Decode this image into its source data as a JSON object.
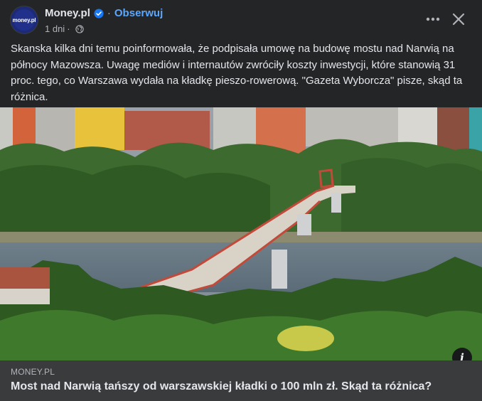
{
  "header": {
    "avatar_text": "money.pl",
    "page_name": "Money.pl",
    "separator": "·",
    "follow_label": "Obserwuj",
    "time": "1 dni",
    "time_separator": "·"
  },
  "post": {
    "text": "Skanska kilka dni temu poinformowała, że podpisała umowę na budowę mostu nad Narwią na północy Mazowsza. Uwagę mediów i internautów zwróciły koszty inwestycji, które stanowią 31 proc. tego, co Warszawa wydała na kładkę pieszo-rowerową. \"Gazeta Wyborcza\" pisze, skąd ta różnica."
  },
  "link": {
    "domain": "MONEY.PL",
    "headline": "Most nad Narwią tańszy od warszawskiej kładki o 100 mln zł. Skąd ta różnica?",
    "info_label": "i"
  },
  "icons": {
    "verified": "verified-badge-icon",
    "privacy": "globe-icon",
    "more": "more-options-icon",
    "close": "close-icon"
  },
  "colors": {
    "background": "#242526",
    "link_box": "#3a3b3c",
    "accent": "#5aa7ff",
    "verified": "#1877f2"
  }
}
